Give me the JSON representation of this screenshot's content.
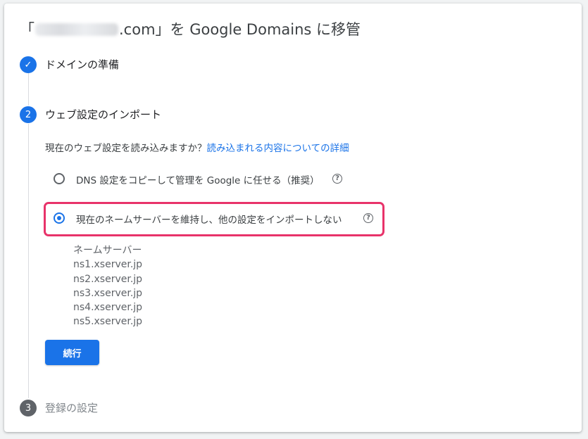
{
  "title": {
    "open_bracket": "「",
    "domain_suffix": ".com",
    "rest": "」を Google Domains に移管"
  },
  "steps": [
    {
      "number": "1",
      "label": "ドメインの準備",
      "state": "completed"
    },
    {
      "number": "2",
      "label": "ウェブ設定のインポート",
      "state": "active"
    },
    {
      "number": "3",
      "label": "登録の設定",
      "state": "pending"
    }
  ],
  "question": {
    "text": "現在のウェブ設定を読み込みますか？",
    "link": "読み込まれる内容についての詳細"
  },
  "options": [
    {
      "label": "DNS 設定をコピーして管理を Google に任せる（推奨）",
      "selected": false
    },
    {
      "label": "現在のネームサーバーを維持し、他の設定をインポートしない",
      "selected": true
    }
  ],
  "nameservers": {
    "heading": "ネームサーバー",
    "items": [
      "ns1.xserver.jp",
      "ns2.xserver.jp",
      "ns3.xserver.jp",
      "ns4.xserver.jp",
      "ns5.xserver.jp"
    ]
  },
  "continue_button": "続行",
  "help_glyph": "?",
  "check_glyph": "✓",
  "colors": {
    "accent": "#1a73e8",
    "highlight": "#e8336a",
    "inactive_step": "#5f6368"
  }
}
